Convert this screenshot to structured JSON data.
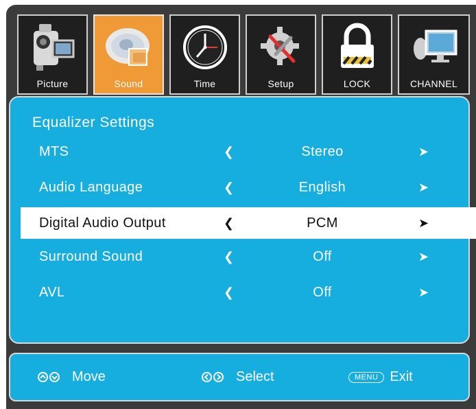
{
  "tabs": [
    {
      "label": "Picture",
      "icon": "camera-icon",
      "active": false
    },
    {
      "label": "Sound",
      "icon": "speaker-disc-icon",
      "active": true
    },
    {
      "label": "Time",
      "icon": "clock-icon",
      "active": false
    },
    {
      "label": "Setup",
      "icon": "gear-wrench-icon",
      "active": false
    },
    {
      "label": "LOCK",
      "icon": "padlock-icon",
      "active": false
    },
    {
      "label": "CHANNEL",
      "icon": "satellite-monitor-icon",
      "active": false
    }
  ],
  "panel": {
    "title": "Equalizer Settings",
    "rows": [
      {
        "label": "MTS",
        "value": "Stereo",
        "selected": false
      },
      {
        "label": "Audio Language",
        "value": "English",
        "selected": false
      },
      {
        "label": "Digital Audio Output",
        "value": "PCM",
        "selected": true
      },
      {
        "label": "Surround Sound",
        "value": "Off",
        "selected": false
      },
      {
        "label": "AVL",
        "value": "Off",
        "selected": false
      }
    ],
    "left_arrow": "❮",
    "right_arrow": "➤"
  },
  "footer": {
    "move_label": "Move",
    "select_label": "Select",
    "menu_key": "MENU",
    "exit_label": "Exit"
  },
  "colors": {
    "panel_bg": "#16aede",
    "frame_bg": "#3b3b3b",
    "active_tab": "#ef9a36",
    "selected_row": "#ffffff"
  }
}
